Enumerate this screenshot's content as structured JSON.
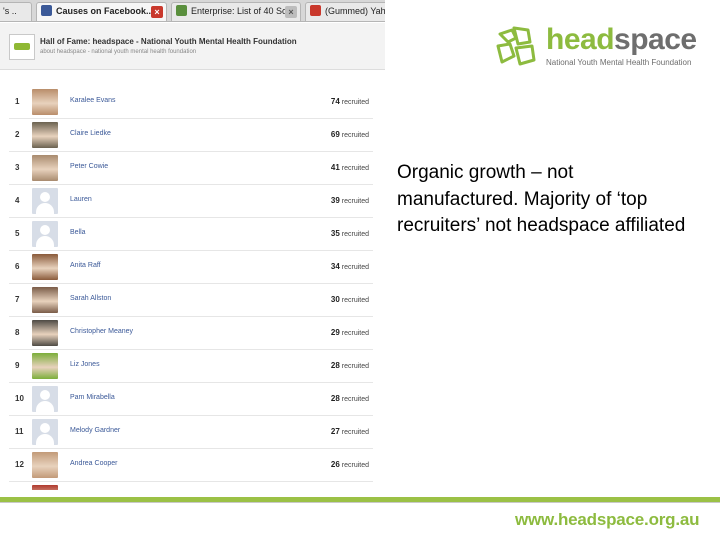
{
  "browser": {
    "tabs": [
      {
        "label": "'s ..",
        "active": false
      },
      {
        "label": "Causes on Facebook...",
        "active": true
      },
      {
        "label": "Enterprise: List of 40 So...",
        "active": false
      },
      {
        "label": "(Gummed) Yah",
        "active": false
      }
    ]
  },
  "page": {
    "title": "Hall of Fame: headspace - National Youth Mental Health Foundation",
    "subtitle": "about headspace - national youth mental health foundation",
    "recruited_label": "recruited",
    "rows": [
      {
        "rank": "1",
        "name": "Karalee Evans",
        "count": "74",
        "avatar": "photo",
        "color": "#b98d6a"
      },
      {
        "rank": "2",
        "name": "Claire Liedke",
        "count": "69",
        "avatar": "photo",
        "color": "#6b6250"
      },
      {
        "rank": "3",
        "name": "Peter Cowie",
        "count": "41",
        "avatar": "photo",
        "color": "#a88a6e"
      },
      {
        "rank": "4",
        "name": "Lauren",
        "count": "39",
        "avatar": "blank",
        "color": "#d7dde7"
      },
      {
        "rank": "5",
        "name": "Bella",
        "count": "35",
        "avatar": "blank",
        "color": "#d7dde7"
      },
      {
        "rank": "6",
        "name": "Anita Raff",
        "count": "34",
        "avatar": "photo",
        "color": "#8a5a3a"
      },
      {
        "rank": "7",
        "name": "Sarah Allston",
        "count": "30",
        "avatar": "photo",
        "color": "#7a5c48"
      },
      {
        "rank": "8",
        "name": "Christopher Meaney",
        "count": "29",
        "avatar": "photo",
        "color": "#4e4a44"
      },
      {
        "rank": "9",
        "name": "Liz Jones",
        "count": "28",
        "avatar": "photo",
        "color": "#7cae3a"
      },
      {
        "rank": "10",
        "name": "Pam Mirabella",
        "count": "28",
        "avatar": "blank",
        "color": "#d7dde7"
      },
      {
        "rank": "11",
        "name": "Melody Gardner",
        "count": "27",
        "avatar": "blank",
        "color": "#d7dde7"
      },
      {
        "rank": "12",
        "name": "Andrea Cooper",
        "count": "26",
        "avatar": "photo",
        "color": "#c29a78"
      },
      {
        "rank": "",
        "name": "",
        "count": "",
        "avatar": "photo",
        "color": "#b03a2e"
      }
    ]
  },
  "brand": {
    "head": "head",
    "space": "space",
    "tagline": "National Youth Mental Health Foundation",
    "green": "#8dbb3f",
    "grey": "#6e6e6e"
  },
  "callout": {
    "text": "Organic growth – not manufactured.  Majority of ‘top recruiters’ not headspace affiliated"
  },
  "footer": {
    "url": "www.headspace.org.au"
  }
}
